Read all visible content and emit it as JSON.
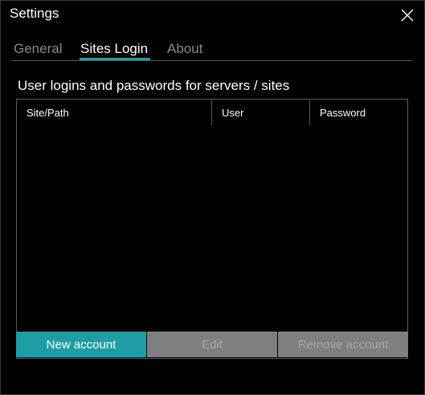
{
  "window": {
    "title": "Settings",
    "close_icon": "close-icon"
  },
  "tabs": [
    {
      "label": "General",
      "active": false
    },
    {
      "label": "Sites Login",
      "active": true
    },
    {
      "label": "About",
      "active": false
    }
  ],
  "sites_login": {
    "heading": "User logins and passwords for servers / sites",
    "columns": [
      "Site/Path",
      "User",
      "Password"
    ],
    "rows": []
  },
  "buttons": {
    "new_account": "New account",
    "edit": "Edit",
    "remove_account": "Remove account"
  },
  "colors": {
    "background": "#000000",
    "accent": "#1e9ea4",
    "disabled_button": "#7f7f7f",
    "disabled_text": "#a9a9a9",
    "inactive_tab": "#8a8a8a",
    "border": "#5a5a5a"
  }
}
